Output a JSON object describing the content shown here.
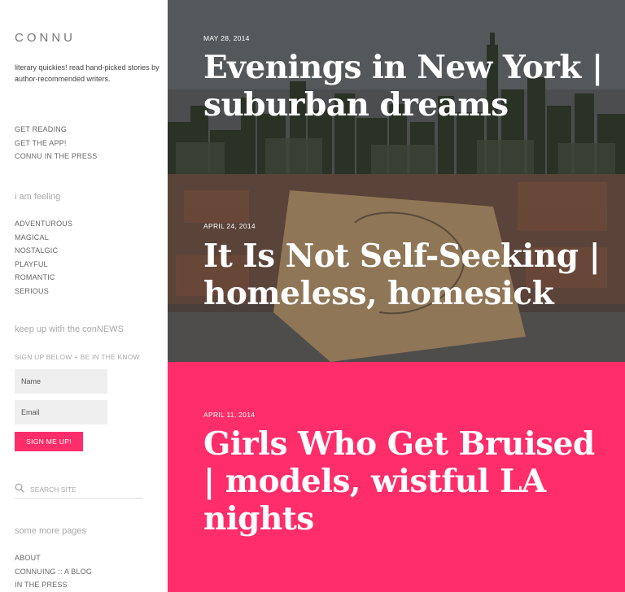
{
  "site": {
    "title": "CONNU",
    "tagline": "literary quickies! read hand-picked stories by author-recommended writers."
  },
  "sidebar": {
    "main_nav": [
      "GET READING",
      "GET THE APP!",
      "CONNU IN THE PRESS"
    ],
    "feeling_heading": "i am feeling",
    "moods": [
      "ADVENTUROUS",
      "MAGICAL",
      "NOSTALGIC",
      "PLAYFUL",
      "ROMANTIC",
      "SERIOUS"
    ],
    "news_heading": "keep up with the conNEWS",
    "signup_note": "SIGN UP BELOW + BE IN THE KNOW",
    "name_placeholder": "Name",
    "email_placeholder": "Email",
    "signup_button": "SIGN ME UP!",
    "search_placeholder": "SEARCH SITE",
    "more_heading": "some more pages",
    "more_pages": [
      "ABOUT",
      "CONNUING :: A BLOG",
      "IN THE PRESS"
    ]
  },
  "posts": [
    {
      "date": "MAY 28, 2014",
      "title": "Evenings in New York | suburban dreams"
    },
    {
      "date": "APRIL 24, 2014",
      "title": "It Is Not Self-Seeking | homeless, homesick"
    },
    {
      "date": "APRIL 11, 2014",
      "title": "Girls Who Get Bruised | models, wistful LA nights"
    }
  ],
  "colors": {
    "accent": "#ff2d6a",
    "field_bg": "#efefef",
    "muted_text": "#aaaaaa"
  },
  "icons": {
    "search": "search-icon"
  }
}
